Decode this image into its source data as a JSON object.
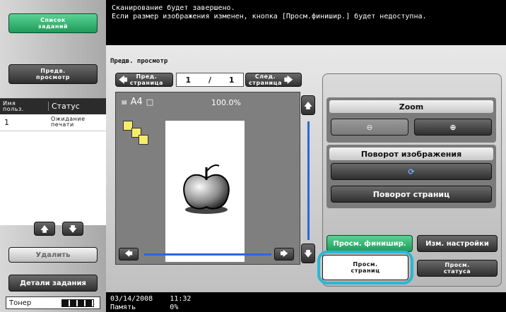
{
  "left": {
    "jobs_button": "Список\nзаданий",
    "preview_button": "Предв.\nпросмотр",
    "table_header_user": "Имя\nпольз.",
    "table_header_status": "Статус",
    "table_row": {
      "user": "1",
      "status": "Ожидание\nпечати"
    },
    "delete_button": "Удалить",
    "details_button": "Детали задания",
    "toner_label": "Тонер"
  },
  "header": {
    "message_line1": "Сканирование будет завершено.",
    "message_line2": "Если размер изображения изменен, кнопка [Просм.финишир.] будет недоступна.",
    "subtitle": "Предв. просмотр"
  },
  "pager": {
    "prev_label": "Пред.\nстраница",
    "page_current": "1",
    "page_sep": "/",
    "page_total": "1",
    "next_label": "След.\nстраница"
  },
  "preview": {
    "paper": "A4",
    "zoom_percent": "100.0%"
  },
  "right": {
    "zoom_title": "Zoom",
    "rotate_title": "Поворот изображения",
    "rotate_pages_button": "Поворот страниц",
    "finishing_button": "Просм. финишир.",
    "change_settings_button": "Изм. настройки",
    "view_pages_button": "Просм.\nстраниц",
    "view_status_button": "Просм.\nстатуса"
  },
  "status_bar": {
    "date": "03/14/2008",
    "time": "11:32",
    "memory_label": "Память",
    "memory_value": "0%"
  },
  "colors": {
    "green": "#2fb36f",
    "highlight": "#29b7d6",
    "panel_gray": "#8a8a8a"
  }
}
